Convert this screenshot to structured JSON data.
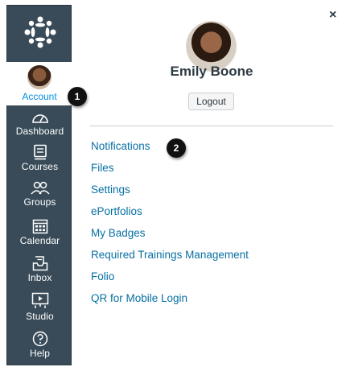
{
  "nav": {
    "account_label": "Account",
    "items": [
      {
        "label": "Dashboard",
        "icon": "dashboard-icon"
      },
      {
        "label": "Courses",
        "icon": "courses-icon"
      },
      {
        "label": "Groups",
        "icon": "groups-icon"
      },
      {
        "label": "Calendar",
        "icon": "calendar-icon"
      },
      {
        "label": "Inbox",
        "icon": "inbox-icon"
      },
      {
        "label": "Studio",
        "icon": "studio-icon"
      },
      {
        "label": "Help",
        "icon": "help-icon"
      }
    ]
  },
  "badges": {
    "one": "1",
    "two": "2"
  },
  "tray": {
    "close_glyph": "×",
    "user_name": "Emily Boone",
    "logout_label": "Logout",
    "links": [
      "Notifications",
      "Files",
      "Settings",
      "ePortfolios",
      "My Badges",
      "Required Trainings Management",
      "Folio",
      "QR for Mobile Login"
    ]
  },
  "colors": {
    "nav_bg": "#394b58",
    "link": "#0770a3",
    "account_label": "#008ee2"
  }
}
